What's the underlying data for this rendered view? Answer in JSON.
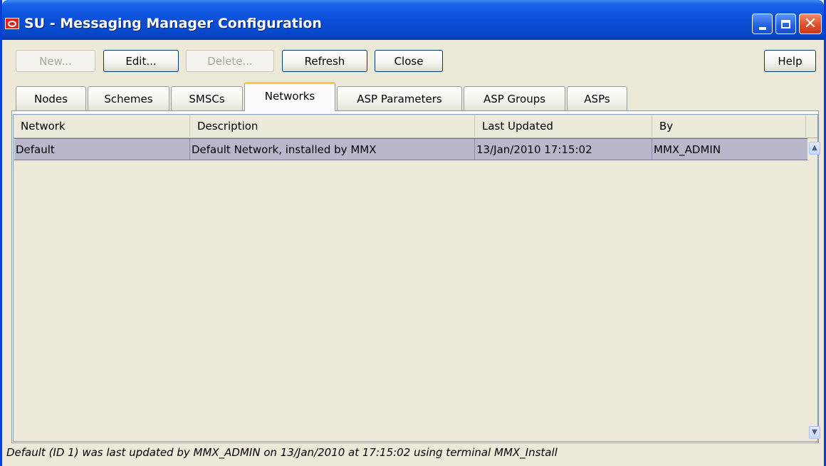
{
  "window": {
    "title": "SU - Messaging Manager Configuration",
    "icon": "oracle-logo-icon"
  },
  "title_buttons": {
    "minimize": "minimize-icon",
    "maximize": "maximize-icon",
    "close_glyph": "✕"
  },
  "toolbar": {
    "new_label": "New...",
    "edit_label": "Edit...",
    "delete_label": "Delete...",
    "refresh_label": "Refresh",
    "close_label": "Close",
    "help_label": "Help"
  },
  "tabs": [
    {
      "label": "Nodes",
      "active": false
    },
    {
      "label": "Schemes",
      "active": false
    },
    {
      "label": "SMSCs",
      "active": false
    },
    {
      "label": "Networks",
      "active": true
    },
    {
      "label": "ASP Parameters",
      "active": false
    },
    {
      "label": "ASP Groups",
      "active": false
    },
    {
      "label": "ASPs",
      "active": false
    }
  ],
  "table": {
    "columns": [
      "Network",
      "Description",
      "Last Updated",
      "By"
    ],
    "rows": [
      {
        "network": "Default",
        "description": "Default Network, installed by MMX",
        "last_updated": "13/Jan/2010 17:15:02",
        "by": "MMX_ADMIN",
        "selected": true
      }
    ]
  },
  "scrollbar": {
    "up": "▲",
    "down": "▼"
  },
  "status_bar": "Default (ID 1) was last updated by MMX_ADMIN on 13/Jan/2010 at 17:15:02 using terminal MMX_Install",
  "colors": {
    "titlebar": "#0a4fd8",
    "selected_row": "#b8b7cb",
    "active_tab_accent": "#ffc83c"
  }
}
